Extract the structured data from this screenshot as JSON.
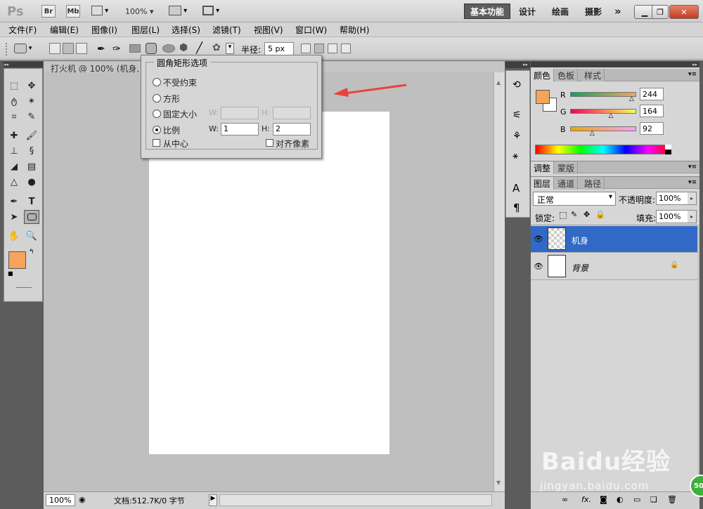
{
  "app": {
    "logo": "Ps",
    "bridge": "Br",
    "minibridge": "Mb",
    "zoom": "100%"
  },
  "workspaces": [
    {
      "label": "基本功能",
      "active": true
    },
    {
      "label": "设计",
      "active": false
    },
    {
      "label": "绘画",
      "active": false
    },
    {
      "label": "摄影",
      "active": false
    }
  ],
  "more": "»",
  "menus": [
    "文件(F)",
    "编辑(E)",
    "图像(I)",
    "图层(L)",
    "选择(S)",
    "滤镜(T)",
    "视图(V)",
    "窗口(W)",
    "帮助(H)"
  ],
  "options": {
    "radius_label": "半径:",
    "radius_value": "5 px"
  },
  "document": {
    "tab": "打火机 @ 100% (机身,",
    "zoom": "100%",
    "status": "文档:512.7K/0 字节"
  },
  "dialog": {
    "title": "圆角矩形选项",
    "opt_unconstrained": "不受约束",
    "opt_square": "方形",
    "opt_fixed": "固定大小",
    "opt_ratio": "比例",
    "w_label": "W:",
    "h_label": "H:",
    "ratio_w": "1",
    "ratio_h": "2",
    "from_center": "从中心",
    "align_pixels": "对齐像素"
  },
  "color_panel": {
    "tabs": [
      "颜色",
      "色板",
      "样式"
    ],
    "r_label": "R",
    "g_label": "G",
    "b_label": "B",
    "r": "244",
    "g": "164",
    "b": "92",
    "r_pct": 0.957,
    "g_pct": 0.643,
    "b_pct": 0.361,
    "fg": "#f4a45c"
  },
  "adjust_tabs": [
    "调整",
    "蒙版"
  ],
  "layers_panel": {
    "tabs": [
      "图层",
      "通道",
      "路径"
    ],
    "blend": "正常",
    "opacity_label": "不透明度:",
    "opacity": "100%",
    "lock_label": "锁定:",
    "fill_label": "填充:",
    "fill": "100%",
    "layers": [
      {
        "name": "机身",
        "selected": true
      },
      {
        "name": "背景",
        "selected": false
      }
    ]
  },
  "watermark": {
    "brand": "Baidu经验",
    "url": "jingyan.baidu.com",
    "badge": "50"
  }
}
